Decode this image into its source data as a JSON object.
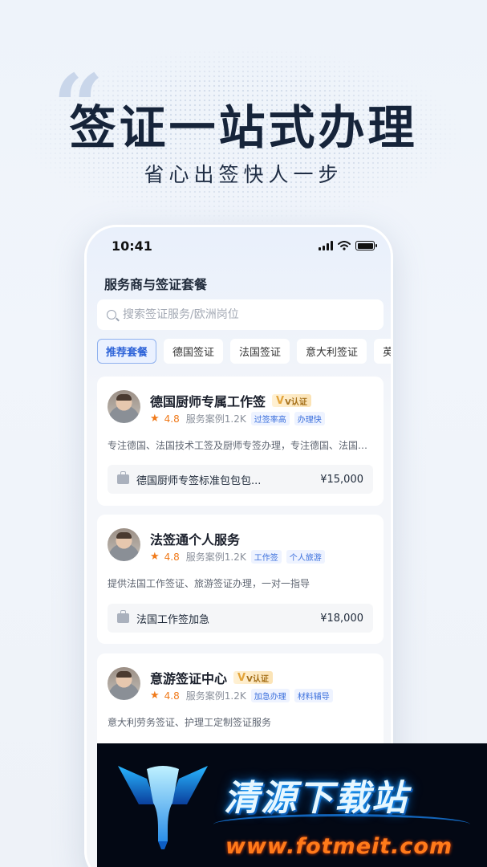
{
  "hero": {
    "title": "签证一站式办理",
    "subtitle": "省心出签快人一步"
  },
  "status_bar": {
    "time": "10:41"
  },
  "page": {
    "title": "服务商与签证套餐"
  },
  "search": {
    "placeholder": "搜索签证服务/欧洲岗位"
  },
  "tabs": [
    {
      "label": "推荐套餐",
      "active": true
    },
    {
      "label": "德国签证"
    },
    {
      "label": "法国签证"
    },
    {
      "label": "意大利签证"
    },
    {
      "label": "英国"
    }
  ],
  "providers": [
    {
      "name": "德国厨师专属工作签",
      "verified_badge": "V认证",
      "rating": "4.8",
      "cases": "服务案例1.2K",
      "tags": [
        "过签率高",
        "办理快"
      ],
      "description": "专注德国、法国技术工签及厨师专签办理，专注德国、法国…",
      "package": {
        "name": "德国厨师专签标准包包包...",
        "price": "¥15,000"
      }
    },
    {
      "name": "法签通个人服务",
      "verified_badge": "",
      "rating": "4.8",
      "cases": "服务案例1.2K",
      "tags": [
        "工作签",
        "个人旅游"
      ],
      "description": "提供法国工作签证、旅游签证办理，一对一指导",
      "package": {
        "name": "法国工作签加急",
        "price": "¥18,000"
      }
    },
    {
      "name": "意游签证中心",
      "verified_badge": "V认证",
      "rating": "4.8",
      "cases": "服务案例1.2K",
      "tags": [
        "加急办理",
        "材料辅导"
      ],
      "description": "意大利劳务签证、护理工定制签证服务"
    }
  ],
  "watermark": {
    "title": "清源下载站",
    "url": "www.fotmeit.com"
  },
  "colors": {
    "accent": "#2d63d8",
    "rating": "#f07a1a",
    "title": "#16243a"
  }
}
